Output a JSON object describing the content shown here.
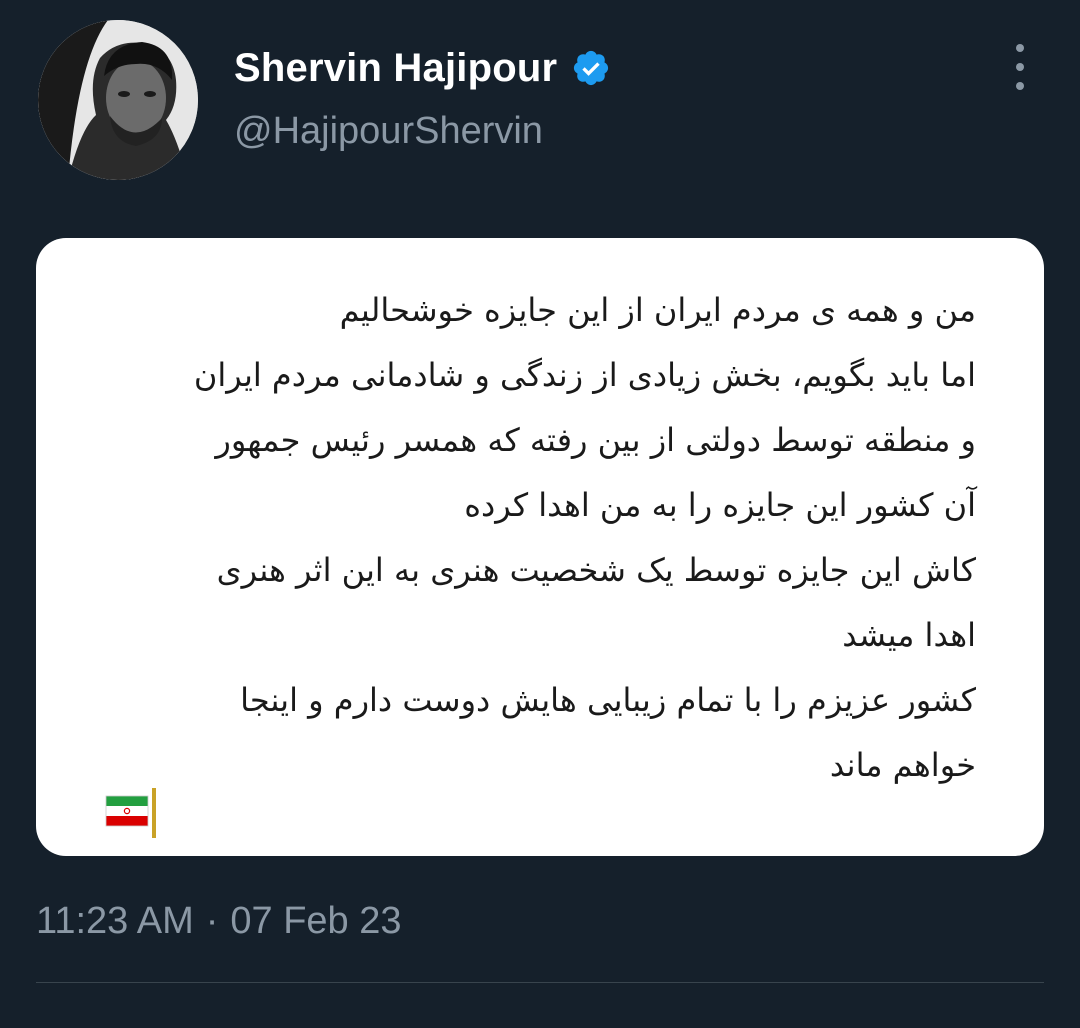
{
  "author": {
    "display_name": "Shervin Hajipour",
    "handle": "@HajipourShervin",
    "verified": true,
    "avatar_icon": "profile-photo"
  },
  "media": {
    "lines": [
      "من و همه ی مردم ایران از این جایزه خوشحالیم",
      "اما باید بگویم، بخش زیادی از زندگی و شادمانی مردم ایران",
      "و منطقه توسط دولتی از بین رفته که همسر رئیس جمهور",
      "آن کشور این جایزه را به من اهدا کرده",
      "کاش این جایزه توسط یک شخصیت هنری به این اثر هنری",
      "اهدا میشد",
      "کشور عزیزم را با تمام زیبایی هایش دوست دارم و اینجا",
      "خواهم ماند"
    ],
    "emoji": "iran-flag"
  },
  "meta": {
    "time": "11:23 AM",
    "separator": "·",
    "date": "07 Feb 23"
  },
  "colors": {
    "background": "#15202b",
    "secondary_text": "#8b98a5",
    "verified": "#1d9bf0",
    "divider": "#38444d"
  }
}
